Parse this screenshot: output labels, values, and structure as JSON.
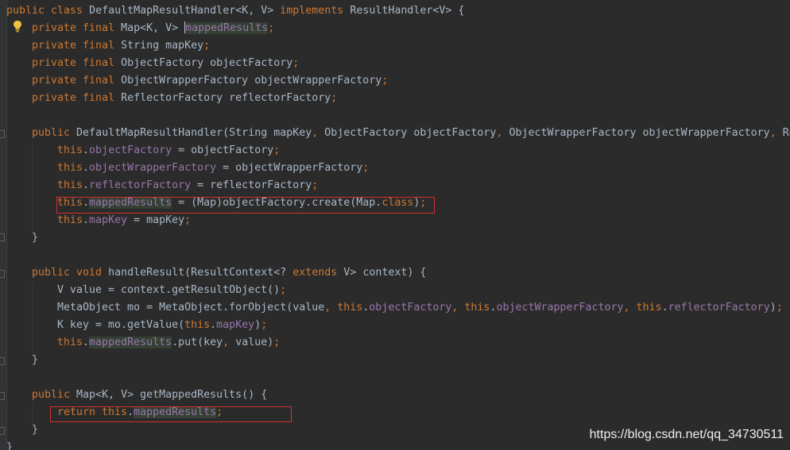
{
  "editor": {
    "lines": [
      {
        "indent": 0,
        "tokens": [
          [
            "kw",
            "public class "
          ],
          [
            "t",
            "DefaultMapResultHandler<K, V> "
          ],
          [
            "kw",
            "implements "
          ],
          [
            "t",
            "ResultHandler<V> {"
          ]
        ]
      },
      {
        "indent": 1,
        "tokens": [
          [
            "kw",
            "private final "
          ],
          [
            "t",
            "Map<K, V> "
          ],
          [
            "caret",
            ""
          ],
          [
            "fldhl",
            "mappedResults"
          ],
          [
            "kw",
            ";"
          ]
        ]
      },
      {
        "indent": 1,
        "tokens": [
          [
            "kw",
            "private final "
          ],
          [
            "t",
            "String mapKey"
          ],
          [
            "kw",
            ";"
          ]
        ]
      },
      {
        "indent": 1,
        "tokens": [
          [
            "kw",
            "private final "
          ],
          [
            "t",
            "ObjectFactory objectFactory"
          ],
          [
            "kw",
            ";"
          ]
        ]
      },
      {
        "indent": 1,
        "tokens": [
          [
            "kw",
            "private final "
          ],
          [
            "t",
            "ObjectWrapperFactory objectWrapperFactory"
          ],
          [
            "kw",
            ";"
          ]
        ]
      },
      {
        "indent": 1,
        "tokens": [
          [
            "kw",
            "private final "
          ],
          [
            "t",
            "ReflectorFactory reflectorFactory"
          ],
          [
            "kw",
            ";"
          ]
        ]
      },
      {
        "indent": 0,
        "tokens": []
      },
      {
        "indent": 1,
        "tokens": [
          [
            "kw",
            "public "
          ],
          [
            "t",
            "DefaultMapResultHandler(String mapKey"
          ],
          [
            "kw",
            ", "
          ],
          [
            "t",
            "ObjectFactory objectFactory"
          ],
          [
            "kw",
            ", "
          ],
          [
            "t",
            "ObjectWrapperFactory objectWrapperFactory"
          ],
          [
            "kw",
            ", "
          ],
          [
            "t",
            "Re"
          ]
        ]
      },
      {
        "indent": 2,
        "tokens": [
          [
            "kw",
            "this"
          ],
          [
            "t",
            "."
          ],
          [
            "fld",
            "objectFactory"
          ],
          [
            "t",
            " = objectFactory"
          ],
          [
            "kw",
            ";"
          ]
        ]
      },
      {
        "indent": 2,
        "tokens": [
          [
            "kw",
            "this"
          ],
          [
            "t",
            "."
          ],
          [
            "fld",
            "objectWrapperFactory"
          ],
          [
            "t",
            " = objectWrapperFactory"
          ],
          [
            "kw",
            ";"
          ]
        ]
      },
      {
        "indent": 2,
        "tokens": [
          [
            "kw",
            "this"
          ],
          [
            "t",
            "."
          ],
          [
            "fld",
            "reflectorFactory"
          ],
          [
            "t",
            " = reflectorFactory"
          ],
          [
            "kw",
            ";"
          ]
        ]
      },
      {
        "indent": 2,
        "tokens": [
          [
            "kw",
            "this"
          ],
          [
            "t",
            "."
          ],
          [
            "fldhl",
            "mappedResults"
          ],
          [
            "t",
            " = (Map)objectFactory.create(Map."
          ],
          [
            "kw",
            "class"
          ],
          [
            "t",
            ")"
          ],
          [
            "kw",
            ";"
          ]
        ]
      },
      {
        "indent": 2,
        "tokens": [
          [
            "kw",
            "this"
          ],
          [
            "t",
            "."
          ],
          [
            "fld",
            "mapKey"
          ],
          [
            "t",
            " = mapKey"
          ],
          [
            "kw",
            ";"
          ]
        ]
      },
      {
        "indent": 1,
        "tokens": [
          [
            "t",
            "}"
          ]
        ]
      },
      {
        "indent": 0,
        "tokens": []
      },
      {
        "indent": 1,
        "tokens": [
          [
            "kw",
            "public void "
          ],
          [
            "t",
            "handleResult(ResultContext<? "
          ],
          [
            "kw",
            "extends "
          ],
          [
            "t",
            "V> context) {"
          ]
        ]
      },
      {
        "indent": 2,
        "tokens": [
          [
            "t",
            "V value = context.getResultObject()"
          ],
          [
            "kw",
            ";"
          ]
        ]
      },
      {
        "indent": 2,
        "tokens": [
          [
            "t",
            "MetaObject mo = MetaObject.forObject(value"
          ],
          [
            "kw",
            ", this"
          ],
          [
            "t",
            "."
          ],
          [
            "fld",
            "objectFactory"
          ],
          [
            "kw",
            ", this"
          ],
          [
            "t",
            "."
          ],
          [
            "fld",
            "objectWrapperFactory"
          ],
          [
            "kw",
            ", this"
          ],
          [
            "t",
            "."
          ],
          [
            "fld",
            "reflectorFactory"
          ],
          [
            "t",
            ")"
          ],
          [
            "kw",
            ";"
          ]
        ]
      },
      {
        "indent": 2,
        "tokens": [
          [
            "t",
            "K key = mo.getValue("
          ],
          [
            "kw",
            "this"
          ],
          [
            "t",
            "."
          ],
          [
            "fld",
            "mapKey"
          ],
          [
            "t",
            ")"
          ],
          [
            "kw",
            ";"
          ]
        ]
      },
      {
        "indent": 2,
        "tokens": [
          [
            "kw",
            "this"
          ],
          [
            "t",
            "."
          ],
          [
            "fldhl",
            "mappedResults"
          ],
          [
            "t",
            ".put(key"
          ],
          [
            "kw",
            ", "
          ],
          [
            "t",
            "value)"
          ],
          [
            "kw",
            ";"
          ]
        ]
      },
      {
        "indent": 1,
        "tokens": [
          [
            "t",
            "}"
          ]
        ]
      },
      {
        "indent": 0,
        "tokens": []
      },
      {
        "indent": 1,
        "tokens": [
          [
            "kw",
            "public "
          ],
          [
            "t",
            "Map<K, V> getMappedResults() {"
          ]
        ]
      },
      {
        "indent": 2,
        "tokens": [
          [
            "kw",
            "return this"
          ],
          [
            "t",
            "."
          ],
          [
            "fldhl",
            "mappedResults"
          ],
          [
            "kw",
            ";"
          ]
        ]
      },
      {
        "indent": 1,
        "tokens": [
          [
            "t",
            "}"
          ]
        ]
      },
      {
        "indent": 0,
        "tokens": [
          [
            "t",
            "}"
          ]
        ]
      }
    ]
  },
  "colors": {
    "background": "#2b2b2b",
    "keyword": "#cc7832",
    "field": "#9876aa",
    "text": "#a9b7c6",
    "usage_highlight": "#344134",
    "annotation_box": "#d32f2f"
  },
  "icons": {
    "gutter_bulb": "lightbulb-icon"
  },
  "watermark": {
    "text": "https://blog.csdn.net/qq_34730511"
  }
}
